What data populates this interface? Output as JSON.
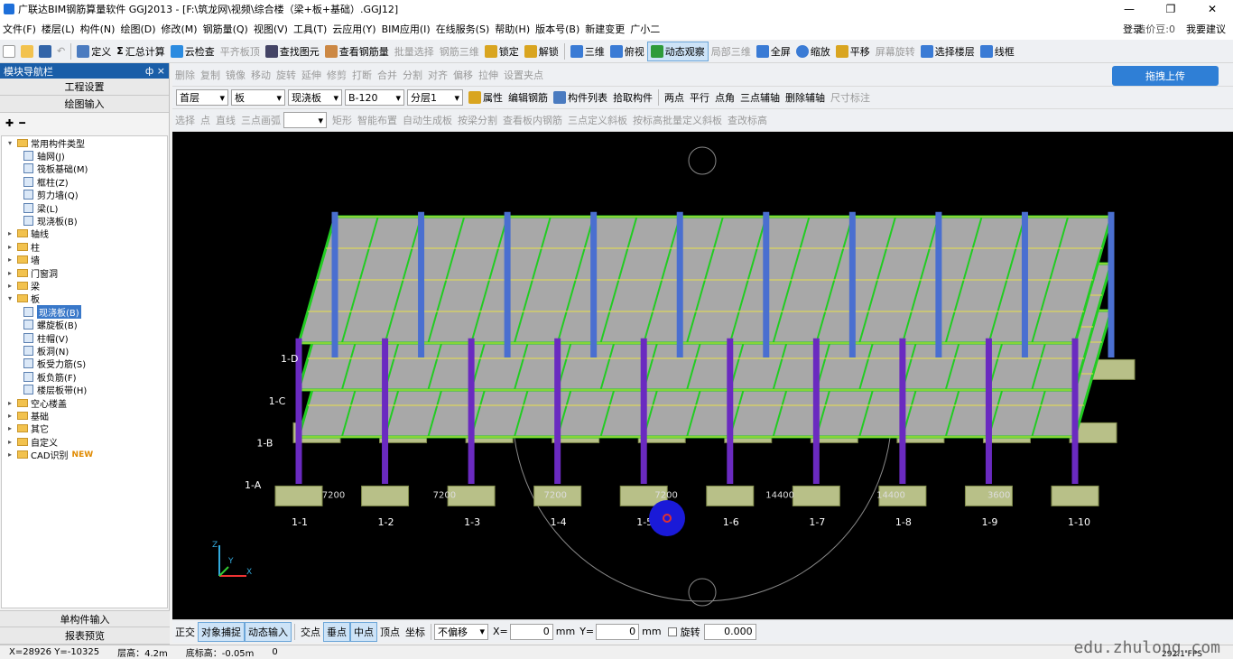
{
  "title": {
    "text": "广联达BIM钢筋算量软件 GGJ2013 - [F:\\筑龙网\\视频\\综合楼（梁+板+基础）.GGJ12]"
  },
  "menu": [
    "文件(F)",
    "楼层(L)",
    "构件(N)",
    "绘图(D)",
    "修改(M)",
    "钢筋量(Q)",
    "视图(V)",
    "工具(T)",
    "云应用(Y)",
    "BIM应用(I)",
    "在线服务(S)",
    "帮助(H)",
    "版本号(B)",
    "新建变更",
    "广小二"
  ],
  "menu_right": {
    "login": "登录",
    "beans": "造价豆:0",
    "suggest": "我要建议"
  },
  "toolbar1": [
    "定义",
    "汇总计算",
    "云检查",
    "平齐板顶",
    "查找图元",
    "查看钢筋量",
    "批量选择",
    "钢筋三维",
    "锁定",
    "解锁",
    "三维",
    "俯视",
    "动态观察",
    "局部三维",
    "全屏",
    "缩放",
    "平移",
    "屏幕旋转",
    "选择楼层",
    "线框"
  ],
  "panel": {
    "title": "模块导航栏",
    "pin": "ф ×",
    "btn_engineering": "工程设置",
    "btn_drawing": "绘图输入",
    "btn_single": "单构件输入",
    "btn_report": "报表预览"
  },
  "tree": [
    {
      "label": "常用构件类型",
      "level": 0,
      "folder": true,
      "open": true
    },
    {
      "label": "轴网(J)",
      "level": 1
    },
    {
      "label": "筏板基础(M)",
      "level": 1
    },
    {
      "label": "框柱(Z)",
      "level": 1
    },
    {
      "label": "剪力墙(Q)",
      "level": 1
    },
    {
      "label": "梁(L)",
      "level": 1
    },
    {
      "label": "现浇板(B)",
      "level": 1
    },
    {
      "label": "轴线",
      "level": 0,
      "folder": true
    },
    {
      "label": "柱",
      "level": 0,
      "folder": true
    },
    {
      "label": "墙",
      "level": 0,
      "folder": true
    },
    {
      "label": "门窗洞",
      "level": 0,
      "folder": true
    },
    {
      "label": "梁",
      "level": 0,
      "folder": true
    },
    {
      "label": "板",
      "level": 0,
      "folder": true,
      "open": true
    },
    {
      "label": "现浇板(B)",
      "level": 1,
      "selected": true
    },
    {
      "label": "螺旋板(B)",
      "level": 1
    },
    {
      "label": "柱帽(V)",
      "level": 1
    },
    {
      "label": "板洞(N)",
      "level": 1
    },
    {
      "label": "板受力筋(S)",
      "level": 1
    },
    {
      "label": "板负筋(F)",
      "level": 1
    },
    {
      "label": "楼层板带(H)",
      "level": 1
    },
    {
      "label": "空心楼盖",
      "level": 0,
      "folder": true
    },
    {
      "label": "基础",
      "level": 0,
      "folder": true
    },
    {
      "label": "其它",
      "level": 0,
      "folder": true
    },
    {
      "label": "自定义",
      "level": 0,
      "folder": true
    },
    {
      "label": "CAD识别",
      "level": 0,
      "folder": true,
      "badge": "NEW"
    }
  ],
  "toolbar2": [
    "删除",
    "复制",
    "镜像",
    "移动",
    "旋转",
    "延伸",
    "修剪",
    "打断",
    "合并",
    "分割",
    "对齐",
    "偏移",
    "拉伸",
    "设置夹点"
  ],
  "upload_btn": "拖拽上传",
  "toolbar3": {
    "floor": "首层",
    "category": "板",
    "type": "现浇板",
    "name": "B-120",
    "layer": "分层1",
    "buttons": [
      "属性",
      "编辑钢筋",
      "构件列表",
      "拾取构件",
      "两点",
      "平行",
      "点角",
      "三点辅轴",
      "删除辅轴",
      "尺寸标注"
    ]
  },
  "toolbar4": [
    "选择",
    "点",
    "直线",
    "三点画弧",
    "矩形",
    "智能布置",
    "自动生成板",
    "按梁分割",
    "查看板内钢筋",
    "三点定义斜板",
    "按标高批量定义斜板",
    "查改标高"
  ],
  "view": {
    "axes_x": [
      "1-1",
      "1-2",
      "1-3",
      "1-4",
      "1-5",
      "1-6",
      "1-7",
      "1-8",
      "1-9",
      "1-10"
    ],
    "axes_y": [
      "1-A",
      "1-B",
      "1-C",
      "1-D"
    ],
    "dims": [
      "7200",
      "7200",
      "7200",
      "7200",
      "14400",
      "14400",
      "3600"
    ],
    "coord_labels": [
      "Z",
      "Y",
      "X"
    ]
  },
  "bottom": {
    "ortho": "正交",
    "snap": "对象捕捉",
    "dyn": "动态输入",
    "intersect": "交点",
    "perp": "垂点",
    "mid": "中点",
    "top": "顶点",
    "coord": "坐标",
    "offset": "不偏移",
    "xlabel": "X=",
    "x": "0",
    "ylabel": "Y=",
    "y": "0",
    "unit": "mm",
    "rotate": "旋转",
    "rotval": "0.000"
  },
  "status": {
    "coords": "X=28926  Y=-10325",
    "floor_h": "层高：4.2m",
    "bottom_h": "底标高：-0.05m",
    "val": "0",
    "fps": "292.1 FPS"
  },
  "watermark": "edu.zhulong.com"
}
